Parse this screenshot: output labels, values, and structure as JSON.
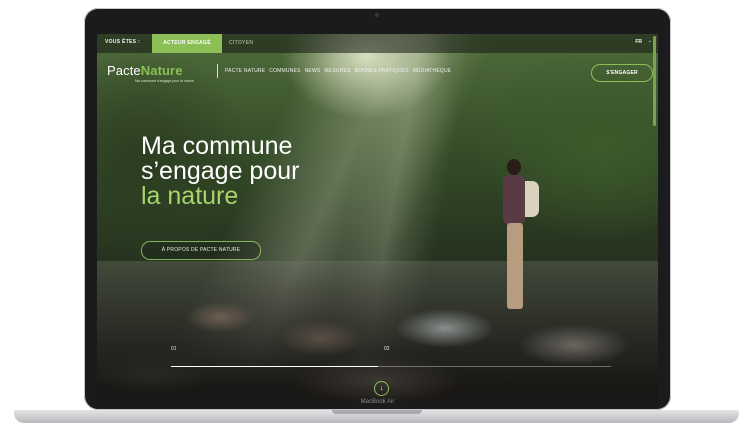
{
  "device": {
    "label": "MacBook Air"
  },
  "topbar": {
    "you_are": "VOUS ÊTES :",
    "tabs": [
      {
        "label": "ACTEUR ENGAGÉ",
        "active": true
      },
      {
        "label": "CITOYEN",
        "active": false
      }
    ],
    "language": "FR",
    "language_chevron": "⌄"
  },
  "header": {
    "logo_part1": "Pacte",
    "logo_part2": "Nature",
    "tagline": "Ma commune s'engage pour la nature",
    "nav": [
      "PACTE NATURE",
      "COMMUNES",
      "NEWS",
      "MESURES",
      "BONNES PRATIQUES",
      "MÉDIATHÈQUE"
    ],
    "cta": "S'ENGAGER"
  },
  "hero": {
    "line1": "Ma commune",
    "line2": "s’engage pour",
    "line3": "la nature",
    "button": "À PROPOS DE PACTE NATURE"
  },
  "slider": {
    "slide_current": "01",
    "slide_next": "02",
    "progress": 0.47,
    "down_icon": "↓"
  },
  "colors": {
    "accent": "#8cc056",
    "hero_accent": "#a8d46a"
  }
}
